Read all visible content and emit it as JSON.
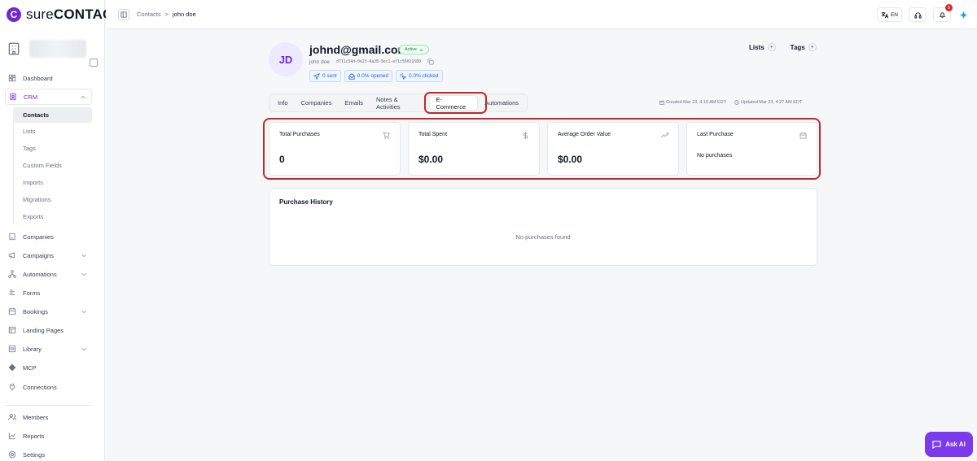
{
  "app": {
    "logo_text_a": "sure",
    "logo_text_b": "CONTACT",
    "logo_mark": "C"
  },
  "sidebar": {
    "items": [
      {
        "label": "Dashboard",
        "icon": "dashboard-icon"
      },
      {
        "label": "CRM",
        "icon": "crm-icon",
        "expanded": true
      },
      {
        "label": "Companies",
        "icon": "building-icon"
      },
      {
        "label": "Campaigns",
        "icon": "megaphone-icon"
      },
      {
        "label": "Automations",
        "icon": "automation-icon"
      },
      {
        "label": "Forms",
        "icon": "form-icon"
      },
      {
        "label": "Bookings",
        "icon": "calendar-icon"
      },
      {
        "label": "Landing Pages",
        "icon": "layout-icon"
      },
      {
        "label": "Library",
        "icon": "library-icon"
      },
      {
        "label": "MCP",
        "icon": "mcp-icon"
      },
      {
        "label": "Connections",
        "icon": "plug-icon"
      },
      {
        "label": "Members",
        "icon": "users-icon"
      },
      {
        "label": "Reports",
        "icon": "chart-icon"
      },
      {
        "label": "Settings",
        "icon": "gear-icon"
      }
    ],
    "crm_sub": [
      "Contacts",
      "Lists",
      "Tags",
      "Custom Fields",
      "Imports",
      "Migrations",
      "Exports"
    ]
  },
  "topbar": {
    "breadcrumb": [
      "Contacts",
      ">",
      "john doe"
    ],
    "lang": "EN",
    "notif_count": "5"
  },
  "contact": {
    "initials": "JD",
    "email": "johnd@gmail.com",
    "status": "Active",
    "name": "john doe",
    "id": "d711c34d-0e23-4a28-9ec1-ef1c56021580",
    "sent": "0 sent",
    "opened": "0.0% opened",
    "clicked": "0.0% clicked"
  },
  "header_actions": {
    "lists": "Lists",
    "tags": "Tags"
  },
  "tabs": [
    "Info",
    "Companies",
    "Emails",
    "Notes & Activities",
    "E-Commerce",
    "Automations"
  ],
  "active_tab": "E-Commerce",
  "dates": {
    "created": "Created Mar 23, 4:19 AM EDT",
    "updated": "Updated Mar 23, 4:27 AM EDT"
  },
  "ecommerce": {
    "cards": [
      {
        "label": "Total Purchases",
        "value": "0",
        "icon": "cart-icon"
      },
      {
        "label": "Total Spent",
        "value": "$0.00",
        "icon": "dollar-icon"
      },
      {
        "label": "Average Order Value",
        "value": "$0.00",
        "icon": "trend-up-icon"
      },
      {
        "label": "Last Purchase",
        "value": "No purchases",
        "icon": "calendar-icon"
      }
    ],
    "history_title": "Purchase History",
    "history_empty": "No purchases found"
  },
  "ask_ai": "Ask AI",
  "colors": {
    "brand": "#6d28d9",
    "highlight": "#c62828",
    "active_green": "#15803d",
    "stat_blue": "#2563eb"
  }
}
